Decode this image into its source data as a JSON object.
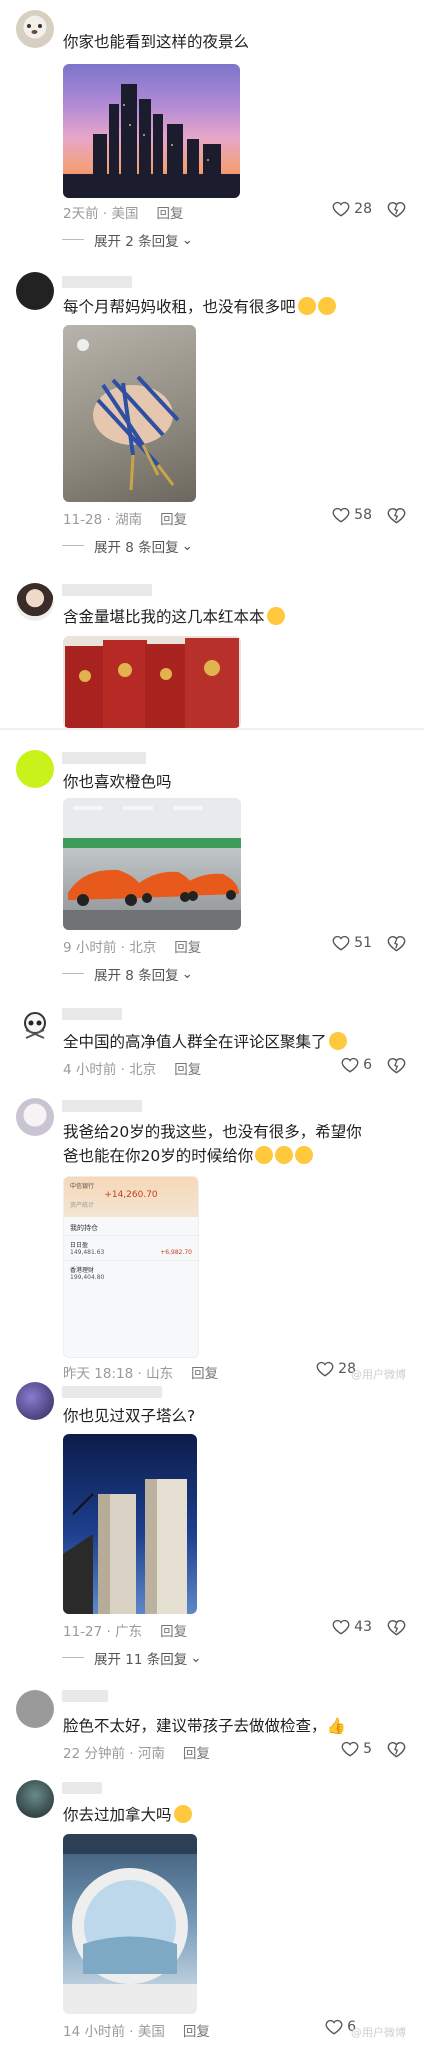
{
  "comments": [
    {
      "text": "你家也能看到这样的夜景么",
      "meta": "2天前 · 美国",
      "reply": "回复",
      "likes": "28",
      "expand": "展开 2 条回复"
    },
    {
      "text": "每个月帮妈妈收租，也没有很多吧",
      "meta": "11-28 · 湖南",
      "reply": "回复",
      "likes": "58",
      "expand": "展开 8 条回复"
    },
    {
      "text": "含金量堪比我的这几本红本本"
    },
    {
      "text": "你也喜欢橙色吗",
      "meta": "9 小时前 · 北京",
      "reply": "回复",
      "likes": "51",
      "expand": "展开 8 条回复"
    },
    {
      "text": "全中国的高净值人群全在评论区聚集了",
      "meta": "4 小时前 · 北京",
      "reply": "回复",
      "likes": "6"
    },
    {
      "text": "我爸给20岁的我这些，也没有很多，希望你爸也能在你20岁的时候给你",
      "meta": "昨天 18:18 · 山东",
      "reply": "回复",
      "likes": "28"
    },
    {
      "text": "你也见过双子塔么?",
      "meta": "11-27 · 广东",
      "reply": "回复",
      "likes": "43",
      "expand": "展开 11 条回复"
    },
    {
      "text": "脸色不太好，建议带孩子去做做检查，",
      "meta": "22 分钟前 · 河南",
      "reply": "回复",
      "likes": "5"
    },
    {
      "text": "你去过加拿大吗",
      "meta": "14 小时前 · 美国",
      "reply": "回复",
      "likes": "6"
    }
  ],
  "finance": {
    "label1": "中信银行",
    "amount": "+14,260.70",
    "app": "资产统计",
    "section": "我的持仓",
    "fund1": "日日盈",
    "fund1_val": "149,481.63",
    "fund2": "香港理财",
    "fund2_val": "199,404.80",
    "gain": "+6,982.70"
  },
  "watermark": "@用户微博",
  "colors": {
    "accent": "#ffc83d",
    "heart": "#666666",
    "meta": "#9a9a9a"
  }
}
